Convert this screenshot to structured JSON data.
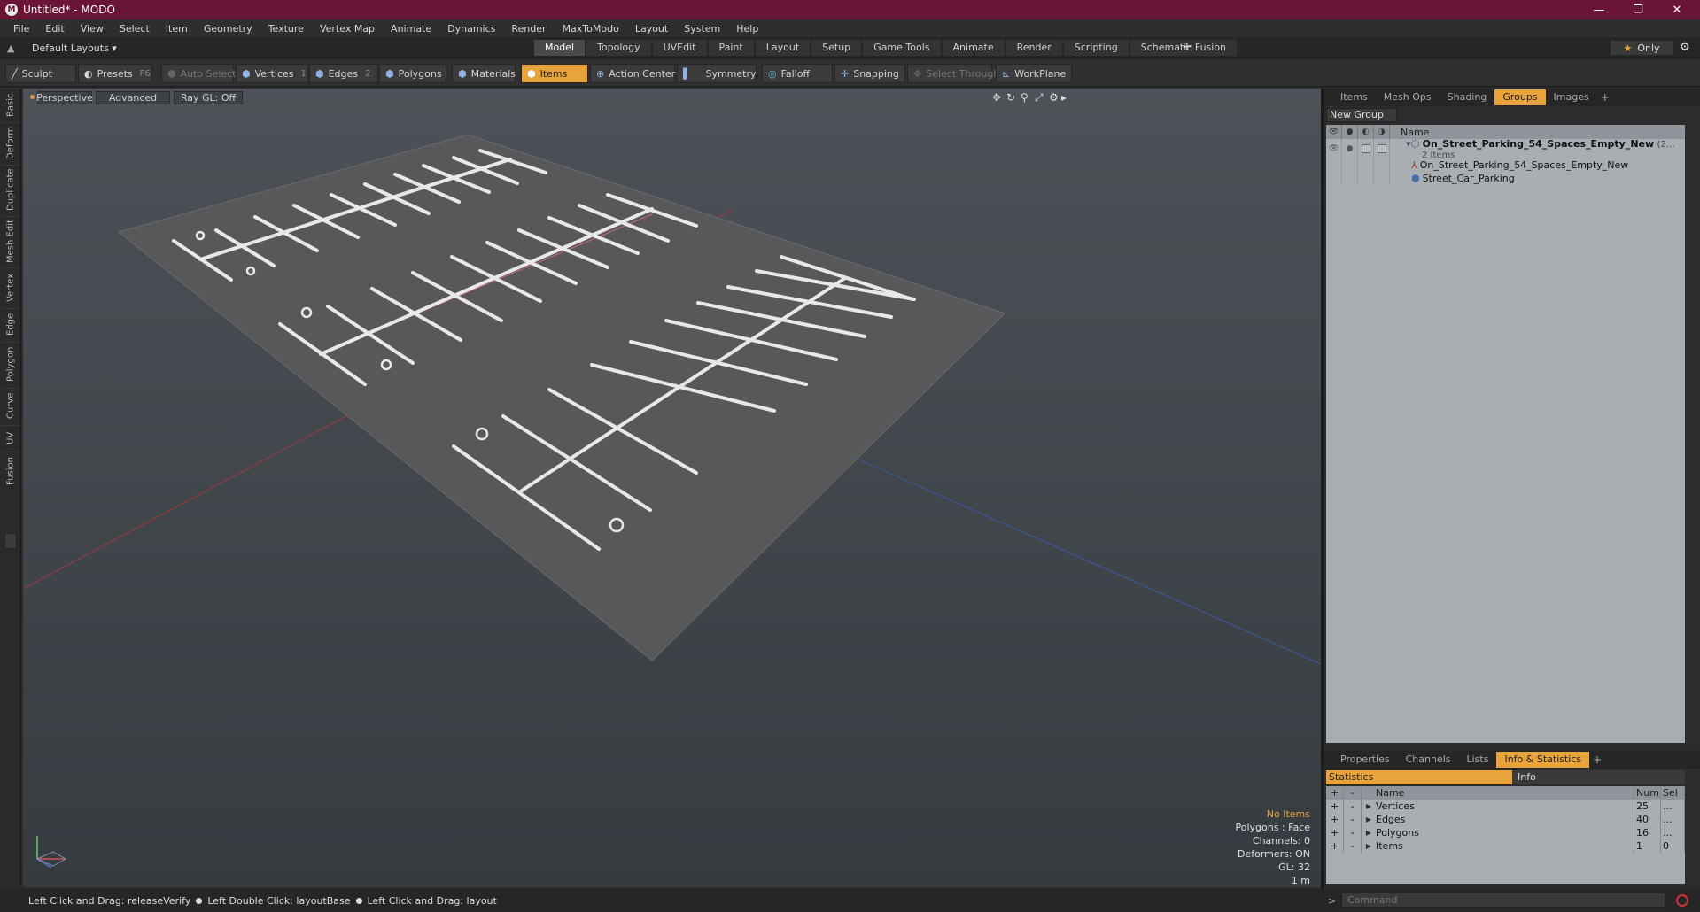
{
  "window": {
    "title": "Untitled* - MODO",
    "minimize": "—",
    "maximize": "❐",
    "close": "✕"
  },
  "menu": [
    "File",
    "Edit",
    "View",
    "Select",
    "Item",
    "Geometry",
    "Texture",
    "Vertex Map",
    "Animate",
    "Dynamics",
    "Render",
    "MaxToModo",
    "Layout",
    "System",
    "Help"
  ],
  "layout_selector": "Default Layouts ▾",
  "layout_tabs": [
    "Model",
    "Topology",
    "UVEdit",
    "Paint",
    "Layout",
    "Setup",
    "Game Tools",
    "Animate",
    "Render",
    "Scripting",
    "Schematic Fusion"
  ],
  "layout_tab_active": "Model",
  "only_button": {
    "star": "★",
    "label": "Only"
  },
  "toolbar": {
    "sculpt": "Sculpt",
    "presets": "Presets",
    "presets_key": "F6",
    "auto_select": "Auto Select",
    "vertices": "Vertices",
    "vertices_key": "1",
    "edges": "Edges",
    "edges_key": "2",
    "polygons": "Polygons",
    "materials": "Materials",
    "items": "Items",
    "action_center": "Action Center",
    "symmetry": "Symmetry",
    "falloff": "Falloff",
    "snapping": "Snapping",
    "select_through": "Select Through",
    "workplane": "WorkPlane"
  },
  "left_tabs": [
    "Basic",
    "Deform",
    "Duplicate",
    "Mesh Edit",
    "Vertex",
    "Edge",
    "Polygon",
    "Curve",
    "UV",
    "Fusion"
  ],
  "viewport": {
    "view": "Perspective",
    "shading": "Advanced",
    "raygl": "Ray GL: Off",
    "info": {
      "selection": "No Items",
      "polygons": "Polygons : Face",
      "channels": "Channels: 0",
      "deformers": "Deformers: ON",
      "gl": "GL: 32",
      "scale": "1 m"
    }
  },
  "top_panel": {
    "tabs": [
      "Items",
      "Mesh Ops",
      "Shading",
      "Groups",
      "Images"
    ],
    "active": "Groups",
    "new_group": "New Group",
    "column_name": "Name",
    "group_name": "On_Street_Parking_54_Spaces_Empty_New",
    "group_suffix": "(2...",
    "group_count": "2 Items",
    "children": [
      "On_Street_Parking_54_Spaces_Empty_New",
      "Street_Car_Parking"
    ]
  },
  "bottom_panel": {
    "tabs": [
      "Properties",
      "Channels",
      "Lists",
      "Info & Statistics"
    ],
    "active": "Info & Statistics",
    "sub_tabs": [
      "Statistics",
      "Info"
    ],
    "columns": {
      "plus": "+",
      "minus": "-",
      "name": "Name",
      "num": "Num",
      "sel": "Sel"
    },
    "rows": [
      {
        "name": "Vertices",
        "num": "25",
        "sel": "..."
      },
      {
        "name": "Edges",
        "num": "40",
        "sel": "..."
      },
      {
        "name": "Polygons",
        "num": "16",
        "sel": "..."
      },
      {
        "name": "Items",
        "num": "1",
        "sel": "0"
      }
    ]
  },
  "status": {
    "hint1": "Left Click and Drag: releaseVerify",
    "hint2": "Left Double Click: layoutBase",
    "hint3": "Left Click and Drag: layout"
  },
  "command": {
    "prompt": ">",
    "placeholder": "Command"
  },
  "colors": {
    "titlebar": "#6a1436",
    "accent": "#e9a33b",
    "viewport_top": "#4c5257"
  }
}
